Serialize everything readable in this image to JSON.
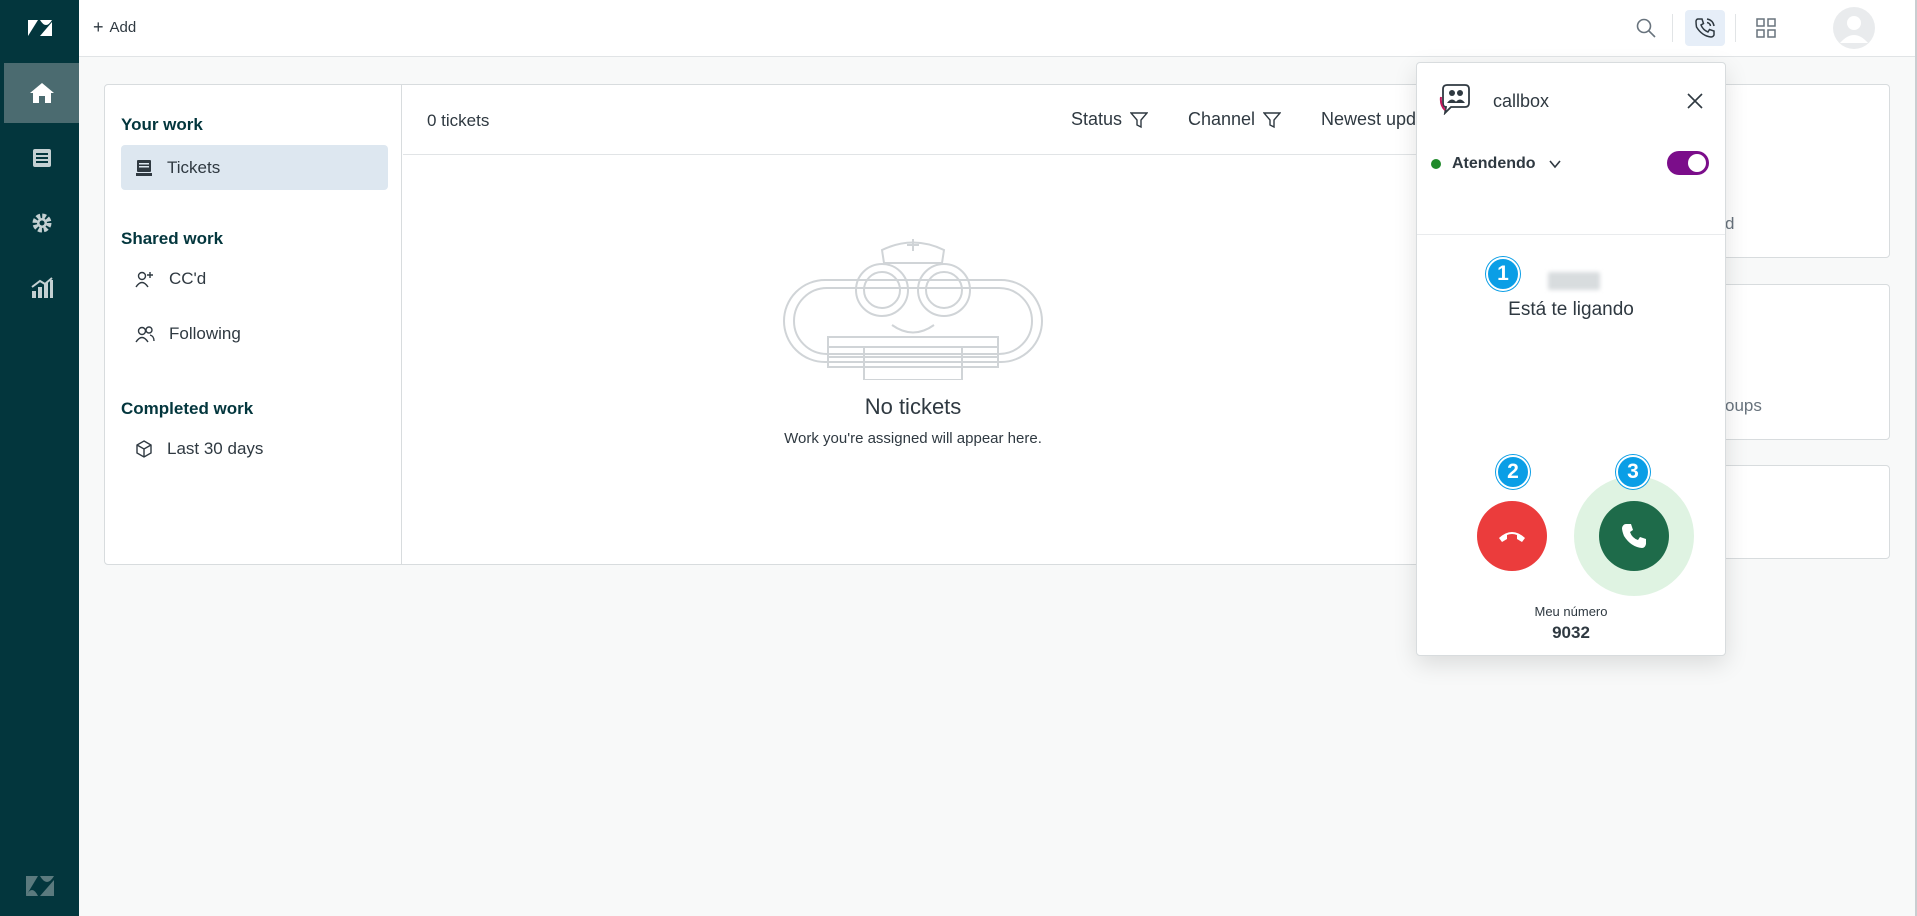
{
  "topbar": {
    "add_label": "Add",
    "icons": [
      "search-icon",
      "phone-icon",
      "apps-icon",
      "avatar"
    ]
  },
  "rail": {
    "icons": [
      "zendesk-logo-icon",
      "home-icon",
      "views-icon",
      "gear-icon",
      "reporting-icon",
      "zendesk-z-icon"
    ]
  },
  "sidebar": {
    "your_work": "Your work",
    "tickets": "Tickets",
    "shared_work": "Shared work",
    "ccd": "CC'd",
    "following": "Following",
    "completed_work": "Completed work",
    "last_30_days": "Last 30 days"
  },
  "list": {
    "count": "0 tickets",
    "filters": [
      "Status",
      "Channel"
    ],
    "sort_label": "Newest upda"
  },
  "empty": {
    "title": "No tickets",
    "subtitle": "Work you're assigned will appear here."
  },
  "right_cards": {
    "card1_text": "d",
    "card2_text": "oups"
  },
  "callbox": {
    "title": "callbox",
    "status": "Atendendo",
    "toggle_on": true,
    "caller_status": "Está te ligando",
    "badges": [
      "1",
      "2",
      "3"
    ],
    "my_number_label": "Meu número",
    "my_number": "9032"
  },
  "colors": {
    "rail": "#03363d",
    "reject": "#eb3c3c",
    "accept": "#1e6b4a",
    "toggle": "#7b0d8a",
    "badge": "#0a9ee6"
  }
}
